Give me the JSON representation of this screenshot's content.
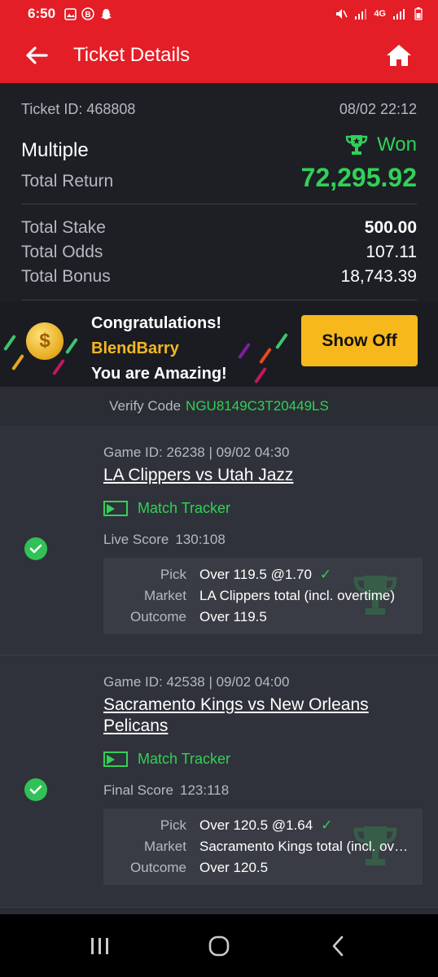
{
  "status_bar": {
    "time": "6:50",
    "network": "4G"
  },
  "header": {
    "title": "Ticket Details"
  },
  "ticket": {
    "id_label": "Ticket ID: 468808",
    "datetime": "08/02 22:12",
    "type": "Multiple",
    "status": "Won",
    "total_return_label": "Total Return",
    "total_return": "72,295.92",
    "total_stake_label": "Total Stake",
    "total_stake": "500.00",
    "total_odds_label": "Total Odds",
    "total_odds": "107.11",
    "total_bonus_label": "Total Bonus",
    "total_bonus": "18,743.39"
  },
  "congrats": {
    "line1": "Congratulations!",
    "name": "BlendBarry",
    "line3": "You are Amazing!",
    "button": "Show Off"
  },
  "verify": {
    "label": "Verify Code",
    "code": "NGU8149C3T20449LS"
  },
  "bets": [
    {
      "game": "Game ID: 26238 | 09/02 04:30",
      "match": "LA Clippers vs Utah Jazz",
      "tracker": "Match Tracker",
      "score_label": "Live Score",
      "score": "130:108",
      "pick_label": "Pick",
      "pick": "Over 119.5 @1.70",
      "market_label": "Market",
      "market": "LA Clippers total (incl. overtime)",
      "outcome_label": "Outcome",
      "outcome": "Over 119.5"
    },
    {
      "game": "Game ID: 42538 | 09/02 04:00",
      "match": "Sacramento Kings vs New Orleans Pelicans",
      "tracker": "Match Tracker",
      "score_label": "Final Score",
      "score": "123:118",
      "pick_label": "Pick",
      "pick": "Over 120.5 @1.64",
      "market_label": "Market",
      "market": "Sacramento Kings total (incl. overtime)",
      "outcome_label": "Outcome",
      "outcome": "Over 120.5"
    }
  ],
  "colors": {
    "brand": "#e41e26",
    "win": "#31d158",
    "accent": "#f6b81b"
  }
}
